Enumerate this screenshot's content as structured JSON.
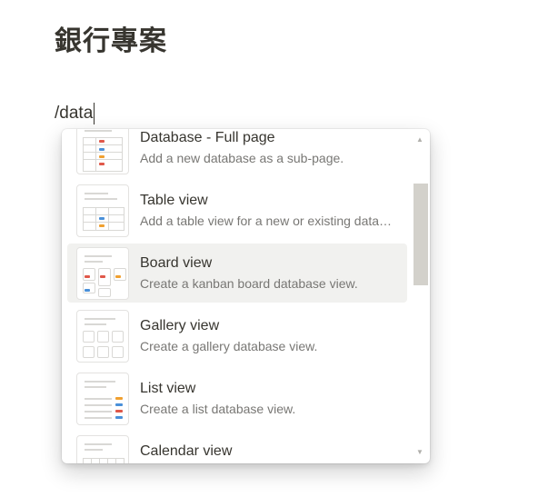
{
  "page": {
    "title": "銀行專案"
  },
  "editor": {
    "command_text": "/data"
  },
  "colors": {
    "accent_blue": "#4a90d9",
    "accent_orange": "#f0a030",
    "accent_red": "#e0584a",
    "hover_bg": "#f1f1ef"
  },
  "menu": {
    "items": [
      {
        "title": "Database - Full page",
        "description": "Add a new database as a sub-page.",
        "icon": "database-full-page-icon"
      },
      {
        "title": "Table view",
        "description": "Add a table view for a new or existing database.",
        "icon": "table-view-icon"
      },
      {
        "title": "Board view",
        "description": "Create a kanban board database view.",
        "icon": "board-view-icon"
      },
      {
        "title": "Gallery view",
        "description": "Create a gallery database view.",
        "icon": "gallery-view-icon"
      },
      {
        "title": "List view",
        "description": "Create a list database view.",
        "icon": "list-view-icon"
      },
      {
        "title": "Calendar view",
        "description": "",
        "icon": "calendar-view-icon"
      }
    ]
  }
}
